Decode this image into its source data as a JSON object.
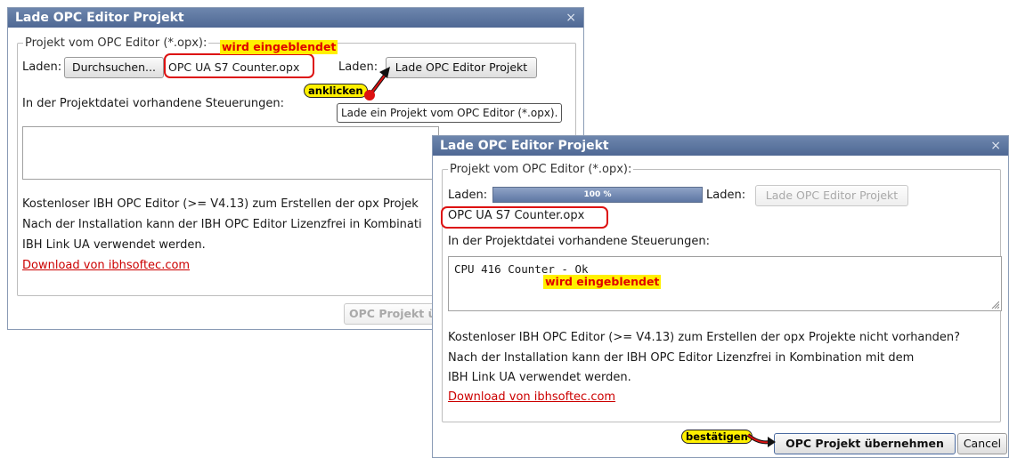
{
  "dialog_back": {
    "title": "Lade OPC Editor Projekt",
    "close": "×",
    "legend": "Projekt vom OPC Editor (*.opx):",
    "laden_label_1": "Laden:",
    "browse_button": "Durchsuchen...",
    "file_name": "OPC UA S7 Counter.opx",
    "laden_label_2": "Laden:",
    "load_button": "Lade OPC Editor Projekt",
    "tooltip": "Lade ein Projekt vom OPC Editor (*.opx).",
    "controllers_label": "In der Projektdatei vorhandene Steuerungen:",
    "info_line1": "Kostenloser IBH OPC Editor (>= V4.13) zum Erstellen der opx Projek",
    "info_line2": "Nach der Installation kann der IBH OPC Editor Lizenzfrei in Kombinati",
    "info_line3": "IBH Link UA verwendet werden.",
    "download_link": "Download von ibhsoftec.com",
    "accept_button": "OPC Projekt ü"
  },
  "dialog_front": {
    "title": "Lade OPC Editor Projekt",
    "close": "×",
    "legend": "Projekt vom OPC Editor (*.opx):",
    "laden_label_1": "Laden:",
    "progress": {
      "value": 1.0,
      "text": "100 %"
    },
    "laden_label_2": "Laden:",
    "load_button": "Lade OPC Editor Projekt",
    "file_name": "OPC UA S7 Counter.opx",
    "controllers_label": "In der Projektdatei vorhandene Steuerungen:",
    "controllers_value": "CPU 416 Counter - Ok",
    "info_line1": "Kostenloser IBH OPC Editor (>= V4.13) zum Erstellen der opx Projekte nicht vorhanden?",
    "info_line2": "Nach der Installation kann der IBH OPC Editor Lizenzfrei in Kombination mit dem",
    "info_line3": "IBH Link UA verwendet werden.",
    "download_link": "Download von ibhsoftec.com",
    "accept_button": "OPC Projekt übernehmen",
    "cancel_button": "Cancel"
  },
  "annotations": {
    "shown_1": "wird eingeblendet",
    "click": "anklicken",
    "shown_2": "wird eingeblendet",
    "confirm": "bestätigen"
  },
  "colors": {
    "titlebar": "#5a74a0",
    "annotation_highlight": "#fff000",
    "annotation_red": "#dd1111",
    "link": "#cc0000"
  }
}
